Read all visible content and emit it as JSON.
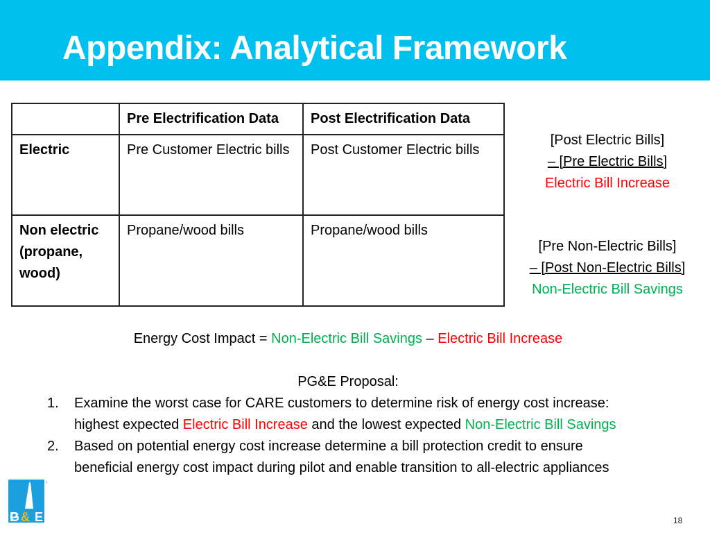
{
  "slide": {
    "title": "Appendix: Analytical Framework",
    "page_number": "18",
    "colors": {
      "header_bg": "#00c0f0",
      "increase": "#ff0000",
      "savings": "#00b050"
    }
  },
  "table": {
    "headers": [
      "",
      "Pre Electrification Data",
      "Post Electrification Data"
    ],
    "rows": [
      {
        "label": "Electric",
        "pre": "Pre Customer Electric bills",
        "post": "Post Customer Electric bills"
      },
      {
        "label": "Non electric (propane, wood)",
        "pre": "Propane/wood bills",
        "post": "Propane/wood bills"
      }
    ]
  },
  "formulas": {
    "electric": {
      "line1": "[Post Electric Bills]",
      "line2": "– [Pre Electric Bills]",
      "result": "Electric Bill Increase"
    },
    "non_electric": {
      "line1": "[Pre Non-Electric Bills]",
      "line2": "– [Post Non-Electric Bills]",
      "result": "Non-Electric Bill Savings"
    }
  },
  "impact": {
    "prefix": "Energy Cost Impact = ",
    "savings": "Non-Electric Bill Savings",
    "operator": " – ",
    "increase": "Electric Bill Increase"
  },
  "proposal": {
    "title": "PG&E Proposal:",
    "items": [
      {
        "number": "1.",
        "text_a": "Examine the worst case for CARE customers to determine risk of energy cost increase: highest expected ",
        "highlight_red": "Electric Bill Increase",
        "text_b": " and the lowest expected ",
        "highlight_green": "Non-Electric Bill Savings"
      },
      {
        "number": "2.",
        "text": "Based on potential energy cost increase determine a bill protection credit to ensure beneficial energy cost impact during pilot and enable transition to all-electric appliances"
      }
    ]
  },
  "logo": {
    "text": "PG&E",
    "icon": "pge-logo-icon"
  }
}
